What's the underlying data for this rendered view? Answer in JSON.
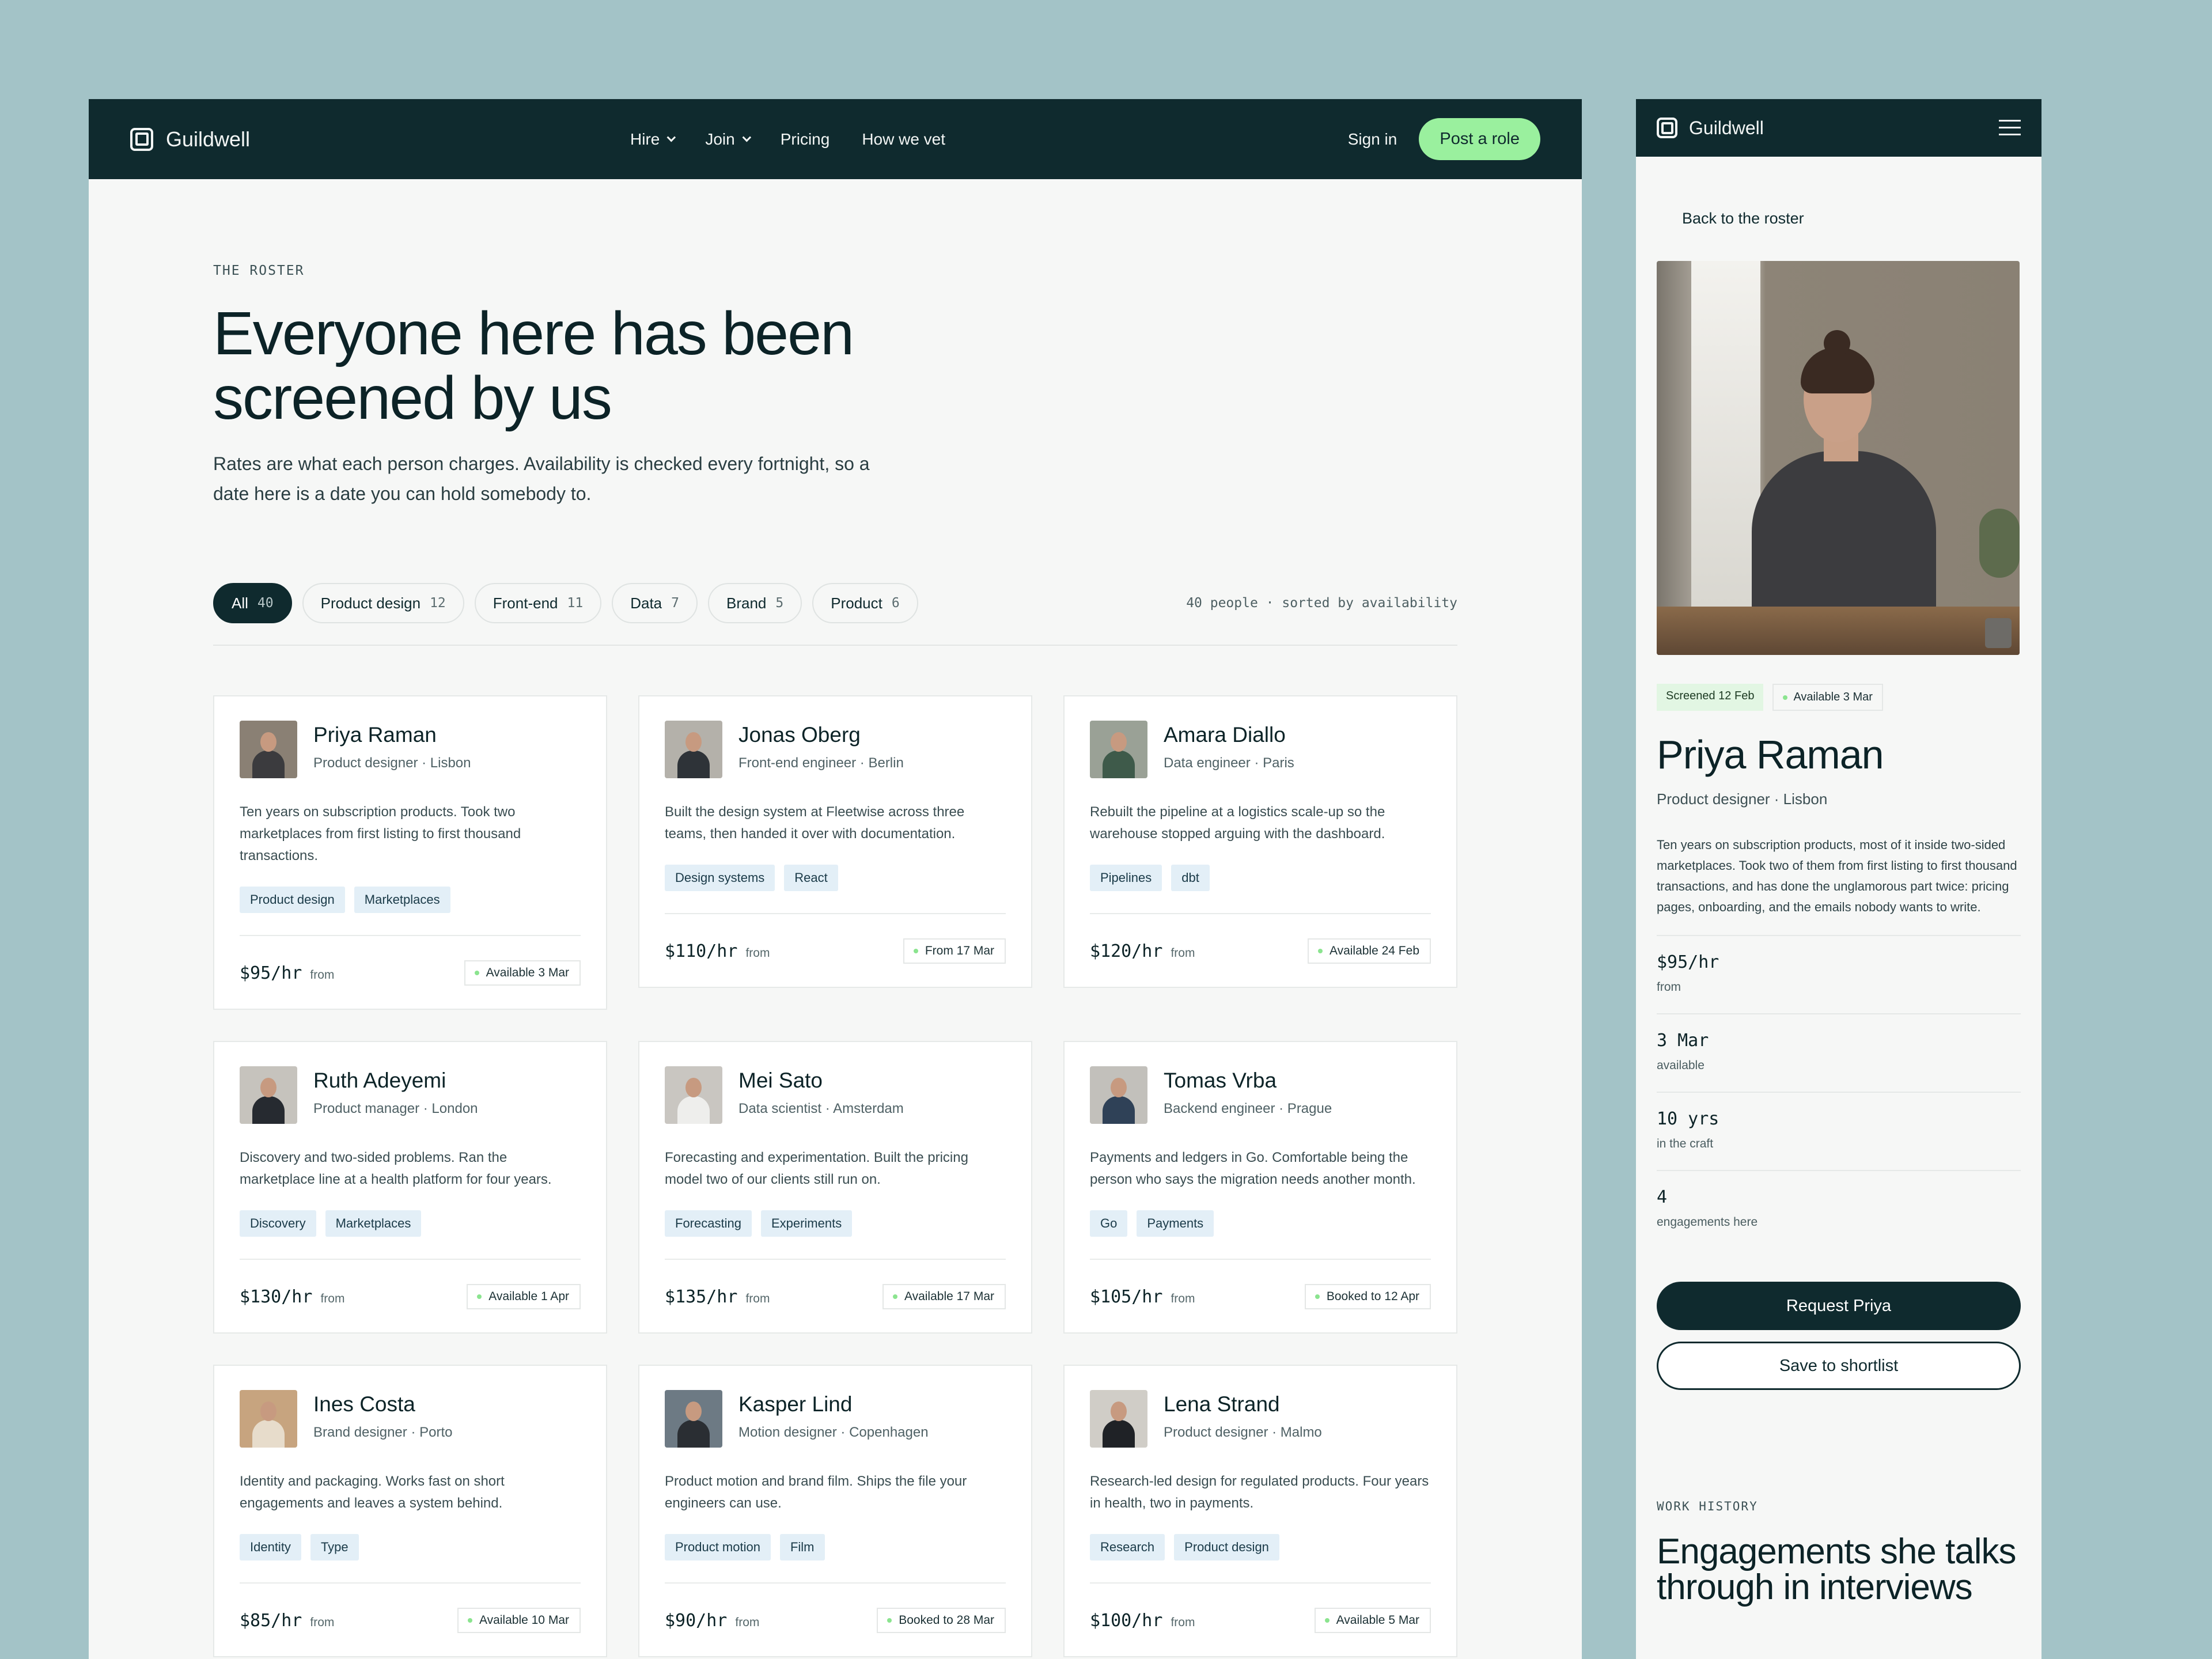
{
  "brand": {
    "name": "Guildwell"
  },
  "nav": [
    {
      "label": "Hire",
      "has_menu": true
    },
    {
      "label": "Join",
      "has_menu": true
    },
    {
      "label": "Pricing",
      "has_menu": false
    },
    {
      "label": "How we vet",
      "has_menu": false
    }
  ],
  "header": {
    "signin": "Sign in",
    "post_role": "Post a role"
  },
  "hero": {
    "eyebrow": "THE ROSTER",
    "title": "Everyone here has been screened by us",
    "subtitle": "Rates are what each person charges. Availability is checked every fortnight, so a date here is a date you can hold somebody to."
  },
  "filters": {
    "chips": [
      {
        "label": "All",
        "count": "40",
        "active": true
      },
      {
        "label": "Product design",
        "count": "12"
      },
      {
        "label": "Front-end",
        "count": "11"
      },
      {
        "label": "Data",
        "count": "7"
      },
      {
        "label": "Brand",
        "count": "5"
      },
      {
        "label": "Product",
        "count": "6"
      }
    ],
    "summary": "40 people · sorted by availability"
  },
  "people": [
    {
      "name": "Priya Raman",
      "role": "Product designer · Lisbon",
      "bio": "Ten years on subscription products. Took two marketplaces from first listing to first thousand transactions.",
      "tags": [
        "Product design",
        "Marketplaces"
      ],
      "rate": "$95/hr",
      "rate_suffix": "from",
      "availability": "Available 3 Mar",
      "colors": {
        "bg": "#8a8074",
        "shirt": "#3b3b3e"
      }
    },
    {
      "name": "Jonas Oberg",
      "role": "Front-end engineer · Berlin",
      "bio": "Built the design system at Fleetwise across three teams, then handed it over with documentation.",
      "tags": [
        "Design systems",
        "React"
      ],
      "rate": "$110/hr",
      "rate_suffix": "from",
      "availability": "From 17 Mar",
      "colors": {
        "bg": "#b4b1aa",
        "shirt": "#2e3338"
      }
    },
    {
      "name": "Amara Diallo",
      "role": "Data engineer · Paris",
      "bio": "Rebuilt the pipeline at a logistics scale-up so the warehouse stopped arguing with the dashboard.",
      "tags": [
        "Pipelines",
        "dbt"
      ],
      "rate": "$120/hr",
      "rate_suffix": "from",
      "availability": "Available 24 Feb",
      "colors": {
        "bg": "#9aa196",
        "shirt": "#3e5a4a"
      }
    },
    {
      "name": "Ruth Adeyemi",
      "role": "Product manager · London",
      "bio": "Discovery and two-sided problems. Ran the marketplace line at a health platform for four years.",
      "tags": [
        "Discovery",
        "Marketplaces"
      ],
      "rate": "$130/hr",
      "rate_suffix": "from",
      "availability": "Available 1 Apr",
      "colors": {
        "bg": "#c6c3bd",
        "shirt": "#262a30"
      }
    },
    {
      "name": "Mei Sato",
      "role": "Data scientist · Amsterdam",
      "bio": "Forecasting and experimentation. Built the pricing model two of our clients still run on.",
      "tags": [
        "Forecasting",
        "Experiments"
      ],
      "rate": "$135/hr",
      "rate_suffix": "from",
      "availability": "Available 17 Mar",
      "colors": {
        "bg": "#c9c6c1",
        "shirt": "#eeeeec"
      }
    },
    {
      "name": "Tomas Vrba",
      "role": "Backend engineer · Prague",
      "bio": "Payments and ledgers in Go. Comfortable being the person who says the migration needs another month.",
      "tags": [
        "Go",
        "Payments"
      ],
      "rate": "$105/hr",
      "rate_suffix": "from",
      "availability": "Booked to 12 Apr",
      "colors": {
        "bg": "#c2c0bb",
        "shirt": "#2f4157"
      }
    },
    {
      "name": "Ines Costa",
      "role": "Brand designer · Porto",
      "bio": "Identity and packaging. Works fast on short engagements and leaves a system behind.",
      "tags": [
        "Identity",
        "Type"
      ],
      "rate": "$85/hr",
      "rate_suffix": "from",
      "availability": "Available 10 Mar",
      "colors": {
        "bg": "#c7a47f",
        "shirt": "#e7dccb"
      }
    },
    {
      "name": "Kasper Lind",
      "role": "Motion designer · Copenhagen",
      "bio": "Product motion and brand film. Ships the file your engineers can use.",
      "tags": [
        "Product motion",
        "Film"
      ],
      "rate": "$90/hr",
      "rate_suffix": "from",
      "availability": "Booked to 28 Mar",
      "colors": {
        "bg": "#6d7a84",
        "shirt": "#2a2e33"
      }
    },
    {
      "name": "Lena Strand",
      "role": "Product designer · Malmo",
      "bio": "Research-led design for regulated products. Four years in health, two in payments.",
      "tags": [
        "Research",
        "Product design"
      ],
      "rate": "$100/hr",
      "rate_suffix": "from",
      "availability": "Available 5 Mar",
      "colors": {
        "bg": "#d0cdc7",
        "shirt": "#1f2226"
      }
    }
  ],
  "mobile": {
    "back": "Back to the roster",
    "screened": "Screened 12 Feb",
    "availability": "Available 3 Mar",
    "name": "Priya Raman",
    "role": "Product designer · Lisbon",
    "bio": "Ten years on subscription products, most of it inside two-sided marketplaces. Took two of them from first listing to first thousand transactions, and has done the unglamorous part twice: pricing pages, onboarding, and the emails nobody wants to write.",
    "stats": [
      {
        "value": "$95/hr",
        "label": "from"
      },
      {
        "value": "3 Mar",
        "label": "available"
      },
      {
        "value": "10 yrs",
        "label": "in the craft"
      },
      {
        "value": "4",
        "label": "engagements here"
      }
    ],
    "request": "Request Priya",
    "shortlist": "Save to shortlist",
    "work_eyebrow": "WORK HISTORY",
    "work_title": "Engagements she talks through in interviews"
  },
  "colors": {
    "dark": "#0f2a2e",
    "accent": "#9af09e",
    "tag_bg": "#e3eff7",
    "dot": "#8be48f"
  }
}
